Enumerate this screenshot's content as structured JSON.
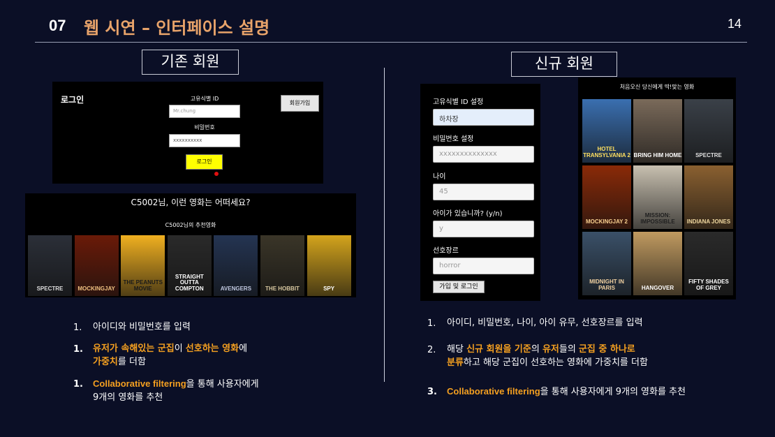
{
  "header": {
    "section_number": "07",
    "title": "웹 시연 – 인터페이스 설명",
    "page_number": "14"
  },
  "left": {
    "section_label": "기존 회원",
    "login": {
      "heading": "로그인",
      "id_label": "고유식별 ID",
      "id_value": "Mr.chung",
      "pw_label": "비밀번호",
      "pw_value": "xxxxxxxxxx",
      "login_button": "로그인",
      "signup_button": "회원가입"
    },
    "recommend": {
      "headline": "C5002님, 이런 영화는 어떠세요?",
      "sublabel": "C5002님의 추천영화",
      "posters": [
        {
          "name": "SPECTRE",
          "bg": "#2b2f38",
          "fg": "#dddddd"
        },
        {
          "name": "MOCKINGJAY",
          "bg": "#6a1a08",
          "fg": "#f0c080"
        },
        {
          "name": "THE PEANUTS MOVIE",
          "bg": "#f0b020",
          "fg": "#1a1a1a"
        },
        {
          "name": "STRAIGHT OUTTA COMPTON",
          "bg": "#2a2a2a",
          "fg": "#ffffff"
        },
        {
          "name": "AVENGERS",
          "bg": "#243452",
          "fg": "#c0c8e0"
        },
        {
          "name": "THE HOBBIT",
          "bg": "#3a3528",
          "fg": "#d8c8a0"
        },
        {
          "name": "SPY",
          "bg": "#d4a41c",
          "fg": "#ffffff"
        }
      ]
    },
    "bullets": [
      {
        "num": "1.",
        "parts": [
          {
            "t": "아이디와 비밀번호를 입력",
            "hl": false
          }
        ]
      },
      {
        "num": "1.",
        "parts": [
          {
            "t": "유저가 속해있는 군집",
            "hl": true
          },
          {
            "t": "이 ",
            "hl": false
          },
          {
            "t": "선호하는 영화",
            "hl": true
          },
          {
            "t": "에",
            "hl": false
          }
        ],
        "line2": [
          {
            "t": "가중치",
            "hl": true
          },
          {
            "t": "를 더함",
            "hl": false
          }
        ]
      },
      {
        "num": "1.",
        "parts": [
          {
            "t": "Collaborative filtering",
            "hl": true
          },
          {
            "t": "을 통해 사용자에게",
            "hl": false
          }
        ],
        "line2": [
          {
            "t": "9개의 영화를 추천",
            "hl": false
          }
        ]
      }
    ]
  },
  "right": {
    "section_label": "신규 회원",
    "signup_form": {
      "id_label": "고유식별 ID 설정",
      "id_value": "하차장",
      "pw_label": "비밀번호 설정",
      "pw_value": "xxxxxxxxxxxxxx",
      "age_label": "나이",
      "age_value": "45",
      "kids_label": "아이가 있습니까? (y/n)",
      "kids_value": "y",
      "genre_label": "선호장르",
      "genre_value": "horror",
      "submit_button": "가입 및 로그인"
    },
    "recommend": {
      "headline": "처음오신 당신에게 딱!맞는 영화",
      "posters": [
        {
          "name": "HOTEL TRANSYLVANIA 2",
          "bg": "#3a6fb0",
          "fg": "#ffe060"
        },
        {
          "name": "BRING HIM HOME",
          "bg": "#7a6a5a",
          "fg": "#ffffff"
        },
        {
          "name": "SPECTRE",
          "bg": "#3a4048",
          "fg": "#e0e0e0"
        },
        {
          "name": "MOCKINGJAY 2",
          "bg": "#8a2a08",
          "fg": "#f8d090"
        },
        {
          "name": "MISSION: IMPOSSIBLE",
          "bg": "#c8c0b0",
          "fg": "#202020"
        },
        {
          "name": "INDIANA JONES",
          "bg": "#8a6030",
          "fg": "#f0d8a0"
        },
        {
          "name": "MIDNIGHT IN PARIS",
          "bg": "#3a5068",
          "fg": "#f0d0a0"
        },
        {
          "name": "HANGOVER",
          "bg": "#c09a60",
          "fg": "#ffffff"
        },
        {
          "name": "FIFTY SHADES OF GREY",
          "bg": "#2a2a2a",
          "fg": "#ffffff"
        }
      ]
    },
    "bullets": [
      {
        "num": "1.",
        "parts": [
          {
            "t": "아이디, 비밀번호, 나이, 아이 유무, 선호장르를 입력",
            "hl": false
          }
        ]
      },
      {
        "num": "2.",
        "parts": [
          {
            "t": "해당 ",
            "hl": false
          },
          {
            "t": "신규 회원을 기준",
            "hl": true
          },
          {
            "t": "의 ",
            "hl": false
          },
          {
            "t": "유저",
            "hl": true
          },
          {
            "t": "들의 ",
            "hl": false
          },
          {
            "t": "군집 중 하나로",
            "hl": true
          }
        ],
        "line2": [
          {
            "t": "분류",
            "hl": true
          },
          {
            "t": "하고 해당 군집이 선호하는 영화에 가중치를 더함",
            "hl": false
          }
        ]
      },
      {
        "num": "3.",
        "parts": [
          {
            "t": "Collaborative filtering",
            "hl": true
          },
          {
            "t": "을 통해 사용자에게 9개의 영화를 추천",
            "hl": false
          }
        ]
      }
    ]
  }
}
